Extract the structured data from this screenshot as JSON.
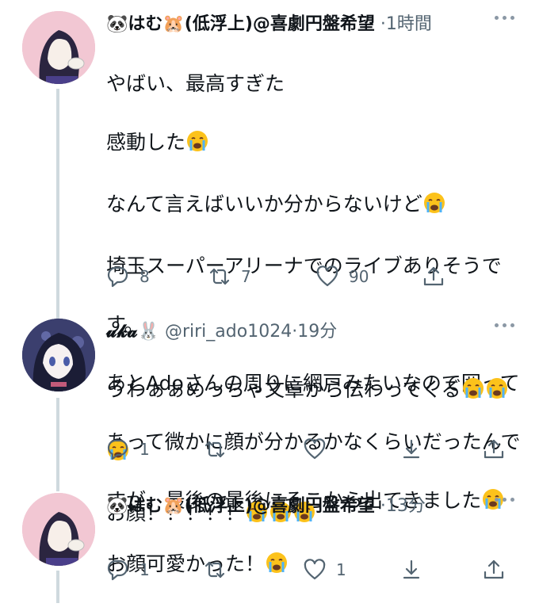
{
  "tweets": [
    {
      "name": "🐼はむ🐹(低浮上)@喜劇円盤希望",
      "handle": "",
      "dot": "·",
      "time": "1時間",
      "lines": [
        "やばい、最高すぎた",
        "感動した",
        "なんて言えばいいか分からないけど",
        "埼玉スーパーアリーナでのライブありそうで",
        "す。",
        "あとAdoさんの周りに網戸みたいなので囲って",
        "あって微かに顔が分かるかなくらいだったんで",
        "すが、最後の最後にそこから出てきました"
      ],
      "reply_count": "8",
      "retweet_count": "7",
      "like_count": "90"
    },
    {
      "name": "𝓾𝓴𝓪🐰",
      "handle": "@riri_ado1024",
      "dot": "·",
      "time": "19分",
      "lines": [
        "うわぁぁめっちゃ文章から伝わってくる",
        "",
        "お顔！！！！！"
      ],
      "reply_count": "1",
      "retweet_count": "",
      "like_count": ""
    },
    {
      "name": "🐼はむ🐹(低浮上)@喜劇円盤希望",
      "handle": "",
      "dot": "·",
      "time": "13分",
      "lines": [
        "お顔可愛かった！"
      ],
      "reply_count": "1",
      "retweet_count": "",
      "like_count": "1"
    }
  ],
  "icons": {
    "reply": "reply-icon",
    "retweet": "retweet-icon",
    "like": "heart-icon",
    "bookmark": "bookmark-icon",
    "share": "share-icon",
    "crying_emoji": "crying-face-emoji"
  },
  "colors": {
    "text": "#0f1419",
    "secondary": "#536471",
    "thread_line": "#cfd9de",
    "avatar1_bg": "#e8b8c8",
    "avatar2_bg": "#2d3160"
  }
}
